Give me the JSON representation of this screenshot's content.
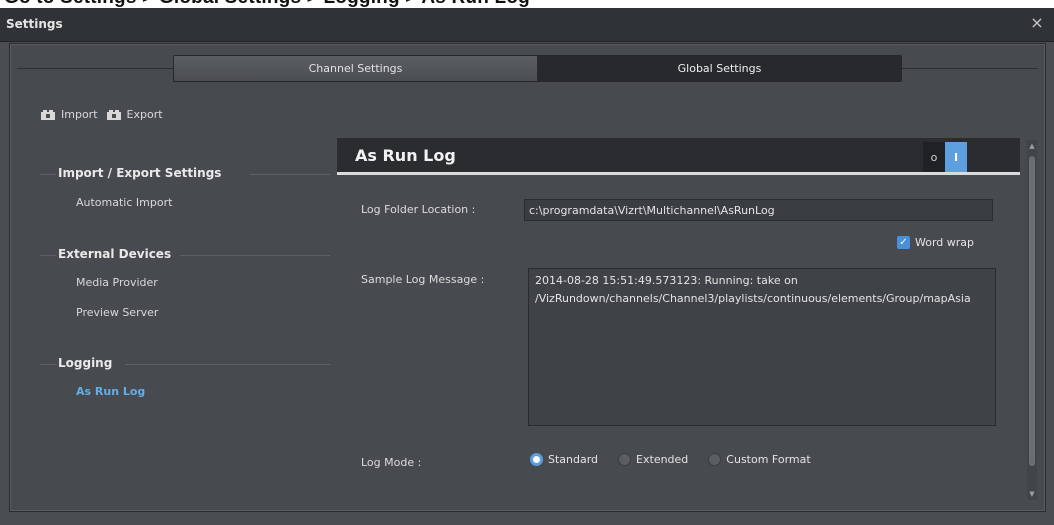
{
  "page_heading": "Go to Settings > Global Settings > Logging > As Run Log",
  "window": {
    "title": "Settings",
    "close_glyph": "×"
  },
  "tabs": [
    {
      "label": "Channel Settings",
      "active": false
    },
    {
      "label": "Global Settings",
      "active": true
    }
  ],
  "toolbar": {
    "import_label": "Import",
    "export_label": "Export",
    "import_icon": "import-icon",
    "export_icon": "export-icon"
  },
  "sidebar": {
    "sections": [
      {
        "header": "Import / Export Settings",
        "items": [
          "Automatic Import"
        ]
      },
      {
        "header": "External Devices",
        "items": [
          "Media Provider",
          "Preview Server"
        ]
      },
      {
        "header": "Logging",
        "items": [
          "As Run Log"
        ]
      }
    ],
    "active_item": "As Run Log"
  },
  "panel": {
    "title": "As Run Log",
    "toggle_off_glyph": "o",
    "toggle_on_glyph": "I",
    "toggle_state": "on",
    "log_folder_label": "Log Folder Location  :",
    "log_folder_value": "c:\\programdata\\Vizrt\\Multichannel\\AsRunLog",
    "word_wrap_label": "Word wrap",
    "word_wrap_checked": true,
    "sample_label": "Sample Log Message :",
    "sample_text": "2014-08-28 15:51:49.573123: Running: take on /VizRundown/channels/Channel3/playlists/continuous/elements/Group/mapAsia",
    "log_mode_label": "Log Mode :",
    "log_mode_options": [
      "Standard",
      "Extended",
      "Custom Format"
    ],
    "log_mode_selected": "Standard"
  },
  "colors": {
    "accent": "#5e9fe0",
    "active_nav": "#63aee8",
    "window_bg": "#4a4d51",
    "titlebar_bg": "#2f3236"
  }
}
